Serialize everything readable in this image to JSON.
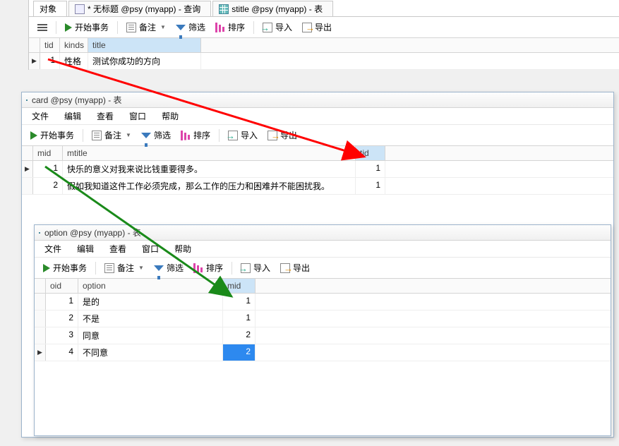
{
  "tabs": [
    {
      "label": "对象"
    },
    {
      "label": "* 无标题 @psy (myapp) - 查询"
    },
    {
      "label": "stitle @psy (myapp) - 表"
    }
  ],
  "toolbar": {
    "start": "开始事务",
    "memo": "备注",
    "filter": "筛选",
    "sort": "排序",
    "import": "导入",
    "export": "导出"
  },
  "menu": [
    "文件",
    "编辑",
    "查看",
    "窗口",
    "帮助"
  ],
  "stitle": {
    "headers": [
      "tid",
      "kinds",
      "title"
    ],
    "rows": [
      {
        "tid": "1",
        "kinds": "性格",
        "title": "测试你成功的方向"
      }
    ]
  },
  "card": {
    "title": "card @psy (myapp) - 表",
    "headers": [
      "mid",
      "mtitle",
      "tid"
    ],
    "rows": [
      {
        "mid": "1",
        "mtitle": "快乐的意义对我来说比钱重要得多。",
        "tid": "1"
      },
      {
        "mid": "2",
        "mtitle": "假如我知道这件工作必须完成，那么工作的压力和困难并不能困扰我。",
        "tid": "1"
      }
    ]
  },
  "option": {
    "title": "option @psy (myapp) - 表",
    "headers": [
      "oid",
      "option",
      "mid"
    ],
    "rows": [
      {
        "oid": "1",
        "option": "是的",
        "mid": "1"
      },
      {
        "oid": "2",
        "option": "不是",
        "mid": "1"
      },
      {
        "oid": "3",
        "option": "同意",
        "mid": "2"
      },
      {
        "oid": "4",
        "option": "不同意",
        "mid": "2"
      }
    ]
  }
}
